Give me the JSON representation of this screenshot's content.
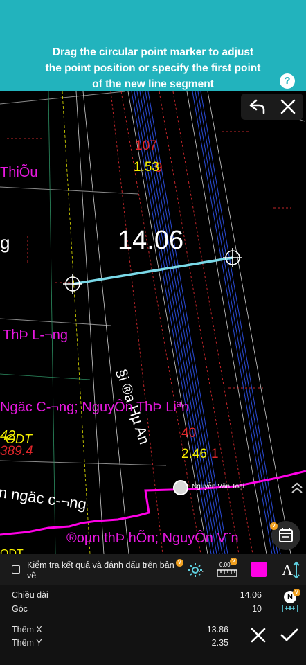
{
  "banner": {
    "instruction": "Drag the circular point marker to adjust\nthe point position or specify the first point\nof the new line segment",
    "help_label": "?"
  },
  "map": {
    "measurement_label": "14.06",
    "labels": {
      "parcel_number_top": "107",
      "parcel_area_top": "1.53",
      "parcel_area_top_shadow": "9",
      "left_name_top": "ThiÕu",
      "left_fragment": "g",
      "left_name_mid": "ThÞ L-¬ng",
      "road_name": "§i ®­a Hµ An",
      "names_line": "Ngäc C-¬ng; NguyÔn ThÞ Liªn",
      "parcel_number_yellow": "42",
      "parcel_code": "ODT",
      "parcel_area_left": "389.4",
      "parcel_number_red": "40",
      "parcel_area_mid": "2.46",
      "parcel_area_mid_shadow": "1",
      "lower_name": "n ngäc c-¬ng",
      "bottom_names": "®oµn thÞ hÕn; NguyÔn V¨n",
      "bottom_fragment": "ODT"
    },
    "user_marker_name": "Nguyễn Văn Toại",
    "layers_badge": "V"
  },
  "toolbar": {
    "checkbox_label": "Kiểm tra kết quả và đánh dấu trên bản vẽ",
    "badge_letter": "V",
    "ruler_label": "0.00",
    "accent_color": "#ff00e6",
    "text_tool_label": "A"
  },
  "measure": {
    "length_label": "Chiều dài",
    "length_value": "14.06",
    "angle_label": "Góc",
    "angle_value": "10",
    "north_label": "N"
  },
  "coords": {
    "x_label": "Thêm X",
    "x_value": "13.86",
    "y_label": "Thêm Y",
    "y_value": "2.35"
  },
  "colors": {
    "banner": "#22b3bd",
    "magenta": "#ff00e6",
    "segment": "#7ad9e8",
    "parcel_red": "#e0262a",
    "parcel_yellow": "#f5f000"
  }
}
